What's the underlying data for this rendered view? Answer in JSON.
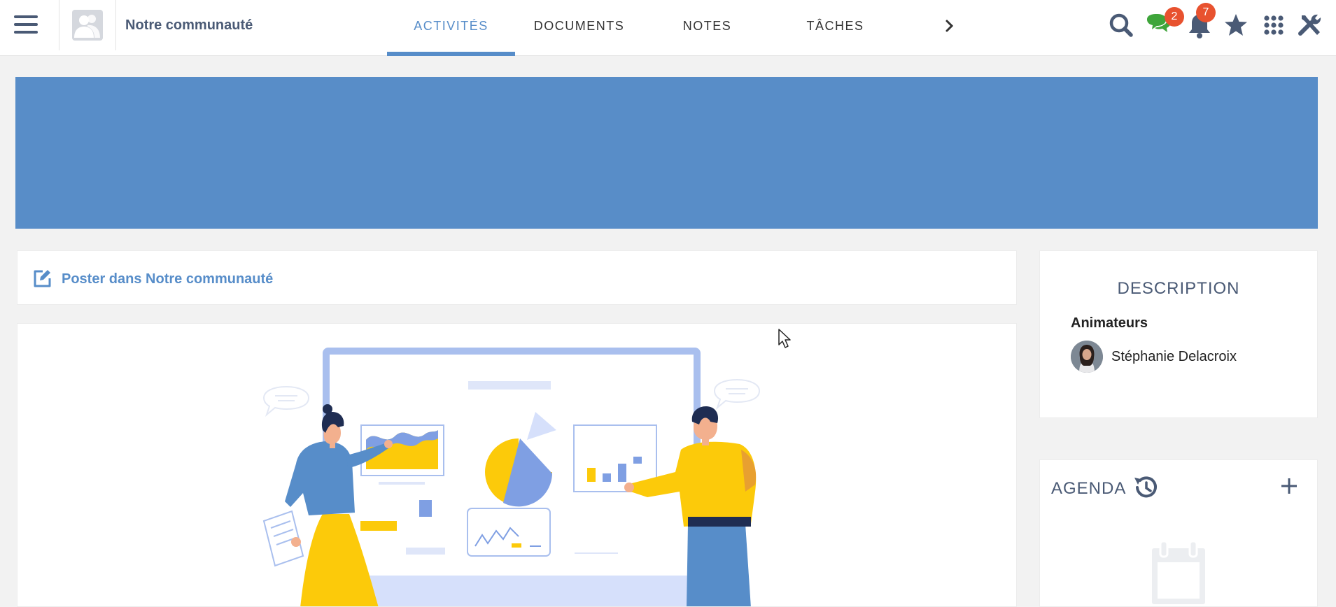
{
  "topbar": {
    "menu_icon": "hamburger-menu-icon",
    "space_name": "Notre communauté",
    "tabs": [
      {
        "label": "ACTIVITÉS",
        "active": true
      },
      {
        "label": "DOCUMENTS",
        "active": false
      },
      {
        "label": "NOTES",
        "active": false
      },
      {
        "label": "TÂCHES",
        "active": false
      }
    ],
    "next_icon": "chevron-right-icon",
    "icons": {
      "search": "search-icon",
      "chat": "chat-icon",
      "notifications": "bell-icon",
      "favorites": "star-icon",
      "apps": "apps-grid-icon",
      "admin": "tools-icon"
    },
    "chat_badge": "2",
    "notif_badge": "7"
  },
  "banner": {
    "color": "#588dc8"
  },
  "composer": {
    "label": "Poster dans Notre communauté",
    "icon": "edit-icon"
  },
  "description": {
    "title": "DESCRIPTION",
    "animators_label": "Animateurs",
    "animators": [
      {
        "name": "Stéphanie Delacroix"
      }
    ]
  },
  "agenda": {
    "title": "AGENDA",
    "history_icon": "history-icon",
    "add_icon": "plus-icon",
    "empty_icon": "calendar-icon"
  },
  "colors": {
    "accent": "#578dc9",
    "text_dark": "#4a5a75",
    "badge": "#e8522f",
    "chat_green": "#3ea53a",
    "illustration_yellow": "#fcca0a",
    "illustration_blue": "#7f9fe3"
  }
}
